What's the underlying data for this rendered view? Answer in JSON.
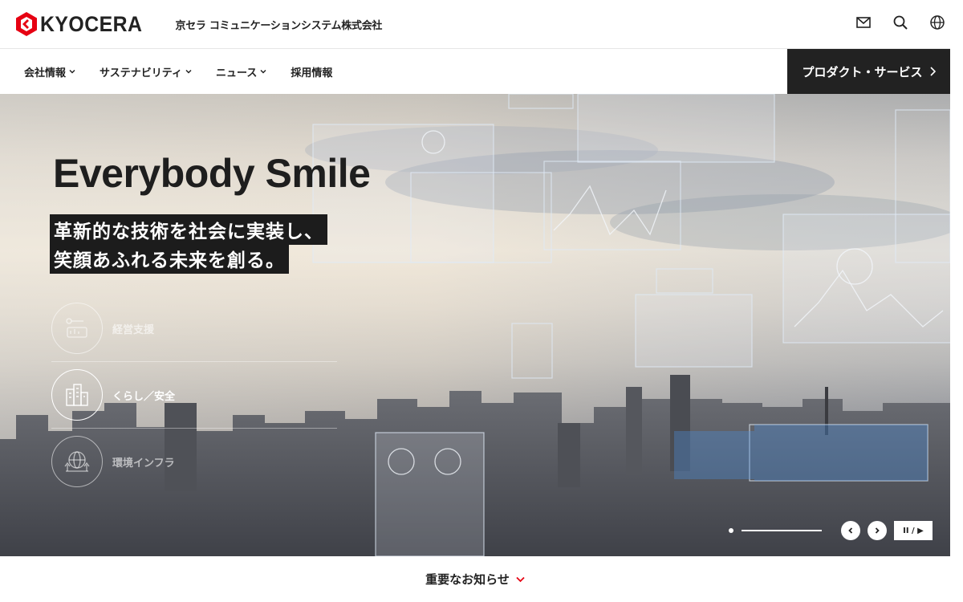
{
  "header": {
    "logo_text": "KYOCERA",
    "company_name": "京セラ コミュニケーションシステム株式会社",
    "icons": [
      "mail-icon",
      "search-icon",
      "globe-icon"
    ],
    "brand_color": "#e60012"
  },
  "nav": {
    "items": [
      {
        "label": "会社情報",
        "has_dropdown": true
      },
      {
        "label": "サステナビリティ",
        "has_dropdown": true
      },
      {
        "label": "ニュース",
        "has_dropdown": true
      },
      {
        "label": "採用情報",
        "has_dropdown": false
      }
    ],
    "cta_label": "プロダクト・サービス"
  },
  "hero": {
    "headline": "Everybody Smile",
    "subline_1": "革新的な技術を社会に実装し、",
    "subline_2": "笑顔あふれる未来を創る。",
    "categories": [
      {
        "label": "経営支援",
        "icon": "business-chart-icon",
        "active": false
      },
      {
        "label": "くらし／安全",
        "icon": "buildings-icon",
        "active": true
      },
      {
        "label": "環境インフラ",
        "icon": "globe-tree-icon",
        "active": false
      }
    ],
    "carousel": {
      "progress": 1.0,
      "pause_label": "II / ▶"
    }
  },
  "notice": {
    "label": "重要なお知らせ",
    "accent_color": "#e60012"
  }
}
